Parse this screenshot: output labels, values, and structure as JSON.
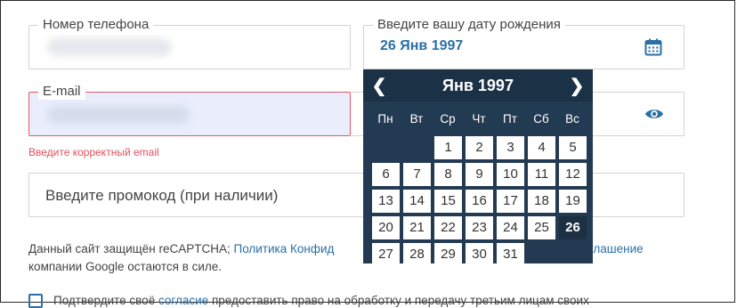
{
  "phone": {
    "label": "Номер телефона"
  },
  "email": {
    "label": "E-mail",
    "error": "Введите корректный email"
  },
  "promo": {
    "placeholder": "Введите промокод (при наличии)"
  },
  "dob": {
    "label": "Введите вашу дату рождения",
    "value": "26 Янв 1997"
  },
  "calendar": {
    "title": "Янв 1997",
    "weekdays": [
      "Пн",
      "Вт",
      "Ср",
      "Чт",
      "Пт",
      "Сб",
      "Вс"
    ],
    "days": [
      "1",
      "2",
      "3",
      "4",
      "5",
      "6",
      "7",
      "8",
      "9",
      "10",
      "11",
      "12",
      "13",
      "14",
      "15",
      "16",
      "17",
      "18",
      "19",
      "20",
      "21",
      "22",
      "23",
      "24",
      "25",
      "26",
      "27",
      "28",
      "29",
      "30",
      "31"
    ],
    "selected": "26"
  },
  "captcha": {
    "text_before": "Данный сайт защищён reCAPTCHA; ",
    "link1": "Политика Конфид",
    "link2": "соглашение",
    "text_after": "компании Google остаются в силе."
  },
  "consent": {
    "text_before": "Подтвердите своё ",
    "link": "согласие",
    "text_after": " предоставить право на обработку и передачу третьим лицам своих"
  }
}
